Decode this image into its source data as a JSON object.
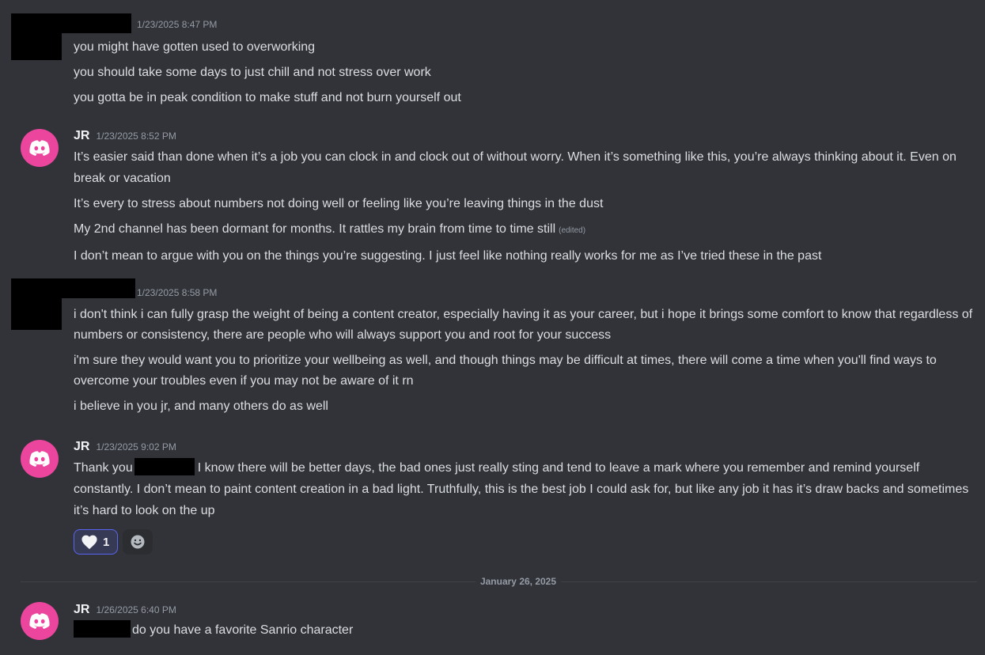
{
  "messages": [
    {
      "timestamp": "1/23/2025 8:47 PM",
      "lines": [
        "you might have gotten used to overworking",
        "you should take some days to just chill and not stress over work",
        "you gotta be in peak condition to make stuff and not burn yourself out"
      ]
    },
    {
      "author": "JR",
      "timestamp": "1/23/2025 8:52 PM",
      "lines": [
        "It’s easier said than done when it’s a job you can clock in and clock out of without worry. When it’s something like this, you’re always thinking about it. Even on break or vacation",
        "It’s every to stress about numbers not doing well or feeling like you’re leaving things in the dust",
        "My 2nd channel has been dormant for months. It rattles my brain from time to time still",
        "I don’t mean to argue with you on the things you’re suggesting. I just feel like nothing really works for me as I’ve tried these in the past"
      ],
      "edited_label": "(edited)"
    },
    {
      "timestamp": "1/23/2025 8:58 PM",
      "lines": [
        "i don't think i can fully grasp the weight of being a content creator, especially having it as your career, but i hope it brings some comfort to know that regardless of numbers or consistency, there are people who will always support you and root for your success",
        "i'm sure they would want you to prioritize your wellbeing as well, and though things may be difficult at times, there will come a time when you'll find ways to overcome your troubles even if you may not be aware of it rn",
        "i believe in you jr, and many others do as well"
      ]
    },
    {
      "author": "JR",
      "timestamp": "1/23/2025 9:02 PM",
      "line_prefix": "Thank you",
      "line_rest": "I know there will be better days, the bad ones just really sting and tend to leave a mark where you remember and remind yourself constantly. I don’t mean to paint content creation in a bad light. Truthfully, this is the best job I could ask for, but like any job it has it’s draw backs and sometimes it’s hard to look on the up",
      "reaction": {
        "icon": "heart-icon",
        "count": "1"
      }
    },
    {
      "author": "JR",
      "timestamp": "1/26/2025 6:40 PM",
      "line_rest": "do you have a favorite Sanrio character"
    }
  ],
  "date_divider": "January 26, 2025",
  "colors": {
    "background": "#323339",
    "avatar": "#eb459e",
    "reaction_border": "#5865f2"
  }
}
